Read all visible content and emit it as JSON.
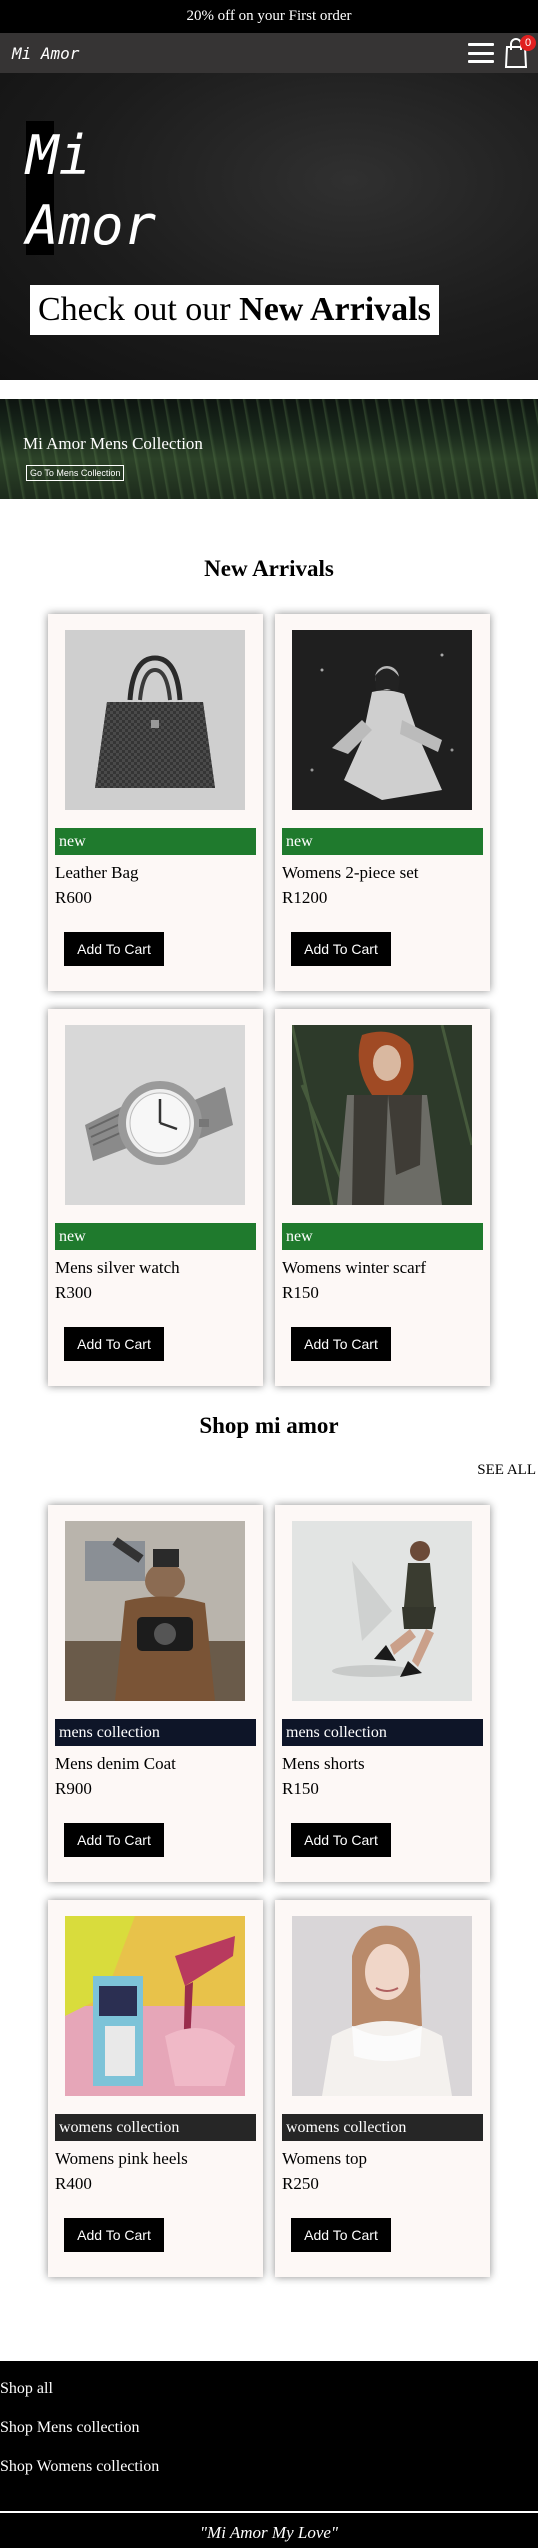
{
  "promo": {
    "text": "20% off on your First order"
  },
  "navbar": {
    "brand": "Mi Amor",
    "cart_count": "0"
  },
  "hero": {
    "title_line1": "Mi",
    "title_line2": "Amor",
    "cta_prefix": "Check out our ",
    "cta_bold": "New Arrivals"
  },
  "mens_banner": {
    "title": "Mi Amor Mens Collection",
    "button": "Go To Mens Collection"
  },
  "new_arrivals": {
    "title": "New Arrivals",
    "products": [
      {
        "tag": "new",
        "name": "Leather Bag",
        "price": "R600",
        "button": "Add To Cart"
      },
      {
        "tag": "new",
        "name": "Womens 2-piece set",
        "price": "R1200",
        "button": "Add To Cart"
      },
      {
        "tag": "new",
        "name": "Mens silver watch",
        "price": "R300",
        "button": "Add To Cart"
      },
      {
        "tag": "new",
        "name": "Womens winter scarf",
        "price": "R150",
        "button": "Add To Cart"
      }
    ]
  },
  "shop": {
    "title": "Shop mi amor",
    "see_all": "SEE ALL",
    "products": [
      {
        "tag": "mens collection",
        "name": "Mens denim Coat",
        "price": "R900",
        "button": "Add To Cart"
      },
      {
        "tag": "mens collection",
        "name": "Mens shorts",
        "price": "R150",
        "button": "Add To Cart"
      },
      {
        "tag": "womens collection",
        "name": "Womens pink heels",
        "price": "R400",
        "button": "Add To Cart"
      },
      {
        "tag": "womens collection",
        "name": "Womens top",
        "price": "R250",
        "button": "Add To Cart"
      }
    ]
  },
  "footer": {
    "links": [
      "Shop all",
      "Shop Mens collection",
      "Shop Womens collection"
    ],
    "quote": "\"Mi Amor My Love\""
  },
  "icons": {
    "menu": "hamburger-menu-icon",
    "cart": "shopping-bag-icon"
  },
  "colors": {
    "new_tag": "#1f7a2d",
    "mens_tag": "#0e1528",
    "womens_tag": "#262626",
    "badge": "#e02020",
    "navbar": "#363434"
  }
}
